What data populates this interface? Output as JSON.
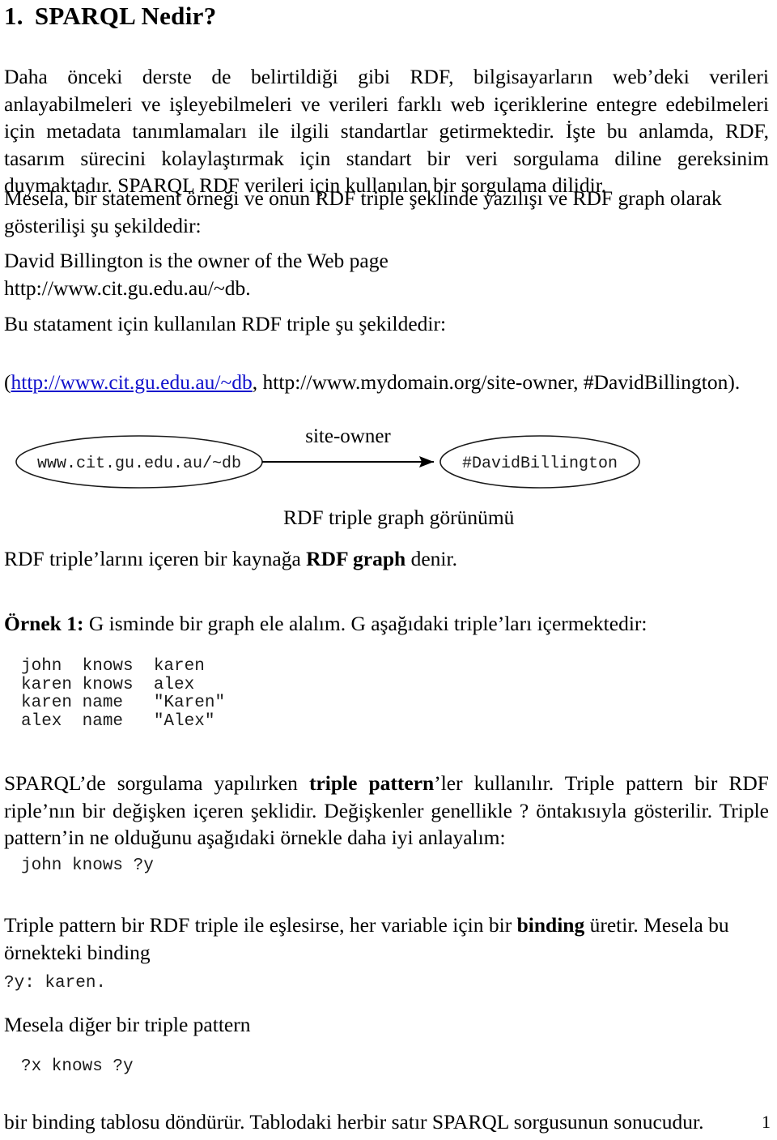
{
  "document": {
    "heading": {
      "number": "1.",
      "text": "SPARQL Nedir?"
    },
    "paragraphs": {
      "p1_part1": "Daha önceki derste de belirtildiği gibi RDF, bilgisayarların web’deki verileri anlayabilmeleri ve işleyebilmeleri ve verileri farklı web içeriklerine entegre edebilmeleri için metadata tanımlamaları ile ilgili standartlar getirmektedir. İşte bu anlamda, RDF, tasarım sürecini kolaylaştırmak için standart bir veri sorgulama diline gereksinim duymaktadır. SPARQL RDF verileri için kullanılan bir sorgulama dilidir.",
      "p2": "Mesela, bir statement örneği ve onun RDF triple şeklinde yazılışı ve RDF graph olarak gösterilişi şu şekildedir:",
      "p3_line1": "David Billington is the owner of the Web page",
      "p3_line2": "http://www.cit.gu.edu.au/~db.",
      "p4": "Bu statament için kullanılan RDF triple şu şekildedir:",
      "p5_prefix": "(",
      "p5_link": "http://www.cit.gu.edu.au/~db",
      "p5_suffix": ", http://www.mydomain.org/site-owner, #DavidBillington).",
      "figure_caption": "RDF triple graph görünümü",
      "p6_prefix": "RDF triple’larını içeren bir kaynağa ",
      "p6_bold": "RDF graph",
      "p6_suffix": " denir.",
      "p7_bold": "Örnek 1:",
      "p7_rest": " G isminde bir graph ele alalım. G aşağıdaki triple’ları içermektedir:",
      "p8_part1": "SPARQL’de sorgulama yapılırken ",
      "p8_bold": "triple pattern",
      "p8_part2": "’ler kullanılır. Triple pattern bir RDF riple’nın bir değişken içeren şeklidir. Değişkenler genellikle ?  öntakısıyla gösterilir.  Triple pattern’in ne olduğunu aşağıdaki örnekle daha  iyi anlayalım:",
      "p9_part1": "Triple pattern bir RDF triple ile eşlesirse, her variable için bir ",
      "p9_bold": "binding",
      "p9_part2": " üretir. Mesela bu örnekteki binding",
      "p10": "Mesela diğer bir triple pattern",
      "p11": "bir binding tablosu döndürür. Tablodaki herbir satır SPARQL sorgusunun sonucudur."
    },
    "code_blocks": {
      "triples_g": "john  knows  karen\nkaren knows  alex\nkaren name   \"Karen\"\nalex  name   \"Alex\"",
      "pattern1": "john knows ?y",
      "binding1": "?y: karen.",
      "pattern2": "?x knows ?y"
    },
    "figure": {
      "subject_label": "www.cit.gu.edu.au/~db",
      "predicate_label": "site-owner",
      "object_label": "#DavidBillington"
    },
    "page_number": "1",
    "colors": {
      "link": "#1111cc",
      "text": "#000000",
      "code": "#1a1a1a"
    }
  }
}
